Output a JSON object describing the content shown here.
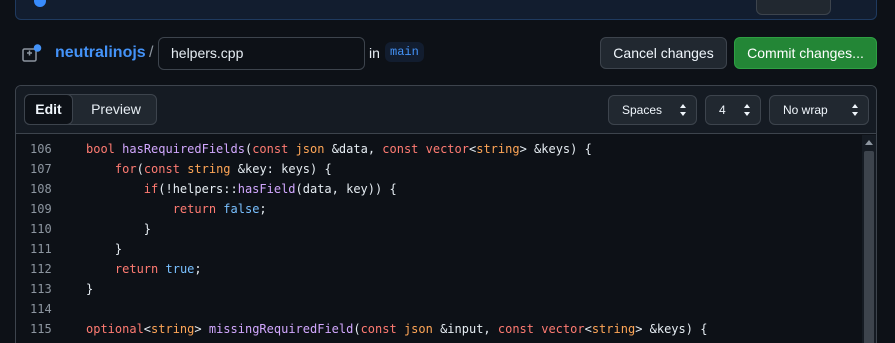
{
  "header": {
    "repo": "neutralinojs",
    "separator": "/",
    "filename": "helpers.cpp",
    "in_label": "in",
    "branch": "main",
    "cancel_label": "Cancel changes",
    "commit_label": "Commit changes..."
  },
  "editor": {
    "tabs": {
      "edit": "Edit",
      "preview": "Preview"
    },
    "indent_mode": "Spaces",
    "indent_size": "4",
    "wrap_mode": "No wrap",
    "line_numbers": [
      "106",
      "107",
      "108",
      "109",
      "110",
      "111",
      "112",
      "113",
      "114",
      "115"
    ],
    "code_lines": [
      "bool hasRequiredFields(const json &data, const vector<string> &keys) {",
      "    for(const string &key: keys) {",
      "        if(!helpers::hasField(data, key)) {",
      "            return false;",
      "        }",
      "    }",
      "    return true;",
      "}",
      "",
      "optional<string> missingRequiredField(const json &input, const vector<string> &keys) {"
    ]
  },
  "icons": {
    "file": "file-diff-icon",
    "select_arrows": "select-arrows-icon",
    "scroll_up": "scroll-up-icon"
  },
  "colors": {
    "accent_blue": "#4493f8",
    "commit_green": "#238636",
    "keyword": "#ff7b72",
    "function": "#d2a8ff",
    "constant": "#79c0ff",
    "type": "#ffa657"
  }
}
